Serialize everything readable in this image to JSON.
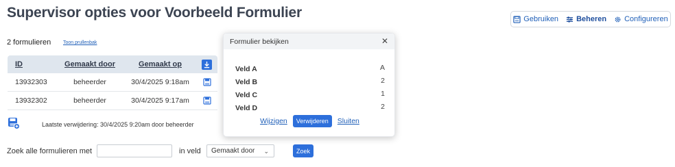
{
  "page": {
    "title": "Supervisor opties voor Voorbeeld Formulier"
  },
  "modes": {
    "use_label": "Gebruiken",
    "manage_label": "Beheren",
    "configure_label": "Configureren"
  },
  "summary": {
    "count_label": "2 formulieren",
    "trash_link": "Toon prullenbak"
  },
  "table": {
    "columns": [
      "ID",
      "Gemaakt door",
      "Gemaakt op"
    ],
    "rows": [
      {
        "id": "13932303",
        "by": "beheerder",
        "on": "30/4/2025 9:18am"
      },
      {
        "id": "13932302",
        "by": "beheerder",
        "on": "30/4/2025 9:17am"
      }
    ]
  },
  "last_deletion": "Laatste verwijdering: 30/4/2025 9:20am door beheerder",
  "search": {
    "label": "Zoek alle formulieren met",
    "input_value": "",
    "field_label": "in veld",
    "field_selected": "Gemaakt door",
    "button_label": "Zoek"
  },
  "modal": {
    "title": "Formulier bekijken",
    "close_glyph": "✕",
    "fields": [
      {
        "label": "Veld A",
        "value": "A"
      },
      {
        "label": "Veld B",
        "value": "2"
      },
      {
        "label": "Veld C",
        "value": "1"
      },
      {
        "label": "Veld D",
        "value": "2"
      }
    ],
    "edit_label": "Wijzigen",
    "delete_label": "Verwijderen",
    "close_label": "Sluiten"
  },
  "colors": {
    "accent": "#2d6fdb",
    "link": "#1f5fb8",
    "header_bg": "#dfe6ee"
  }
}
